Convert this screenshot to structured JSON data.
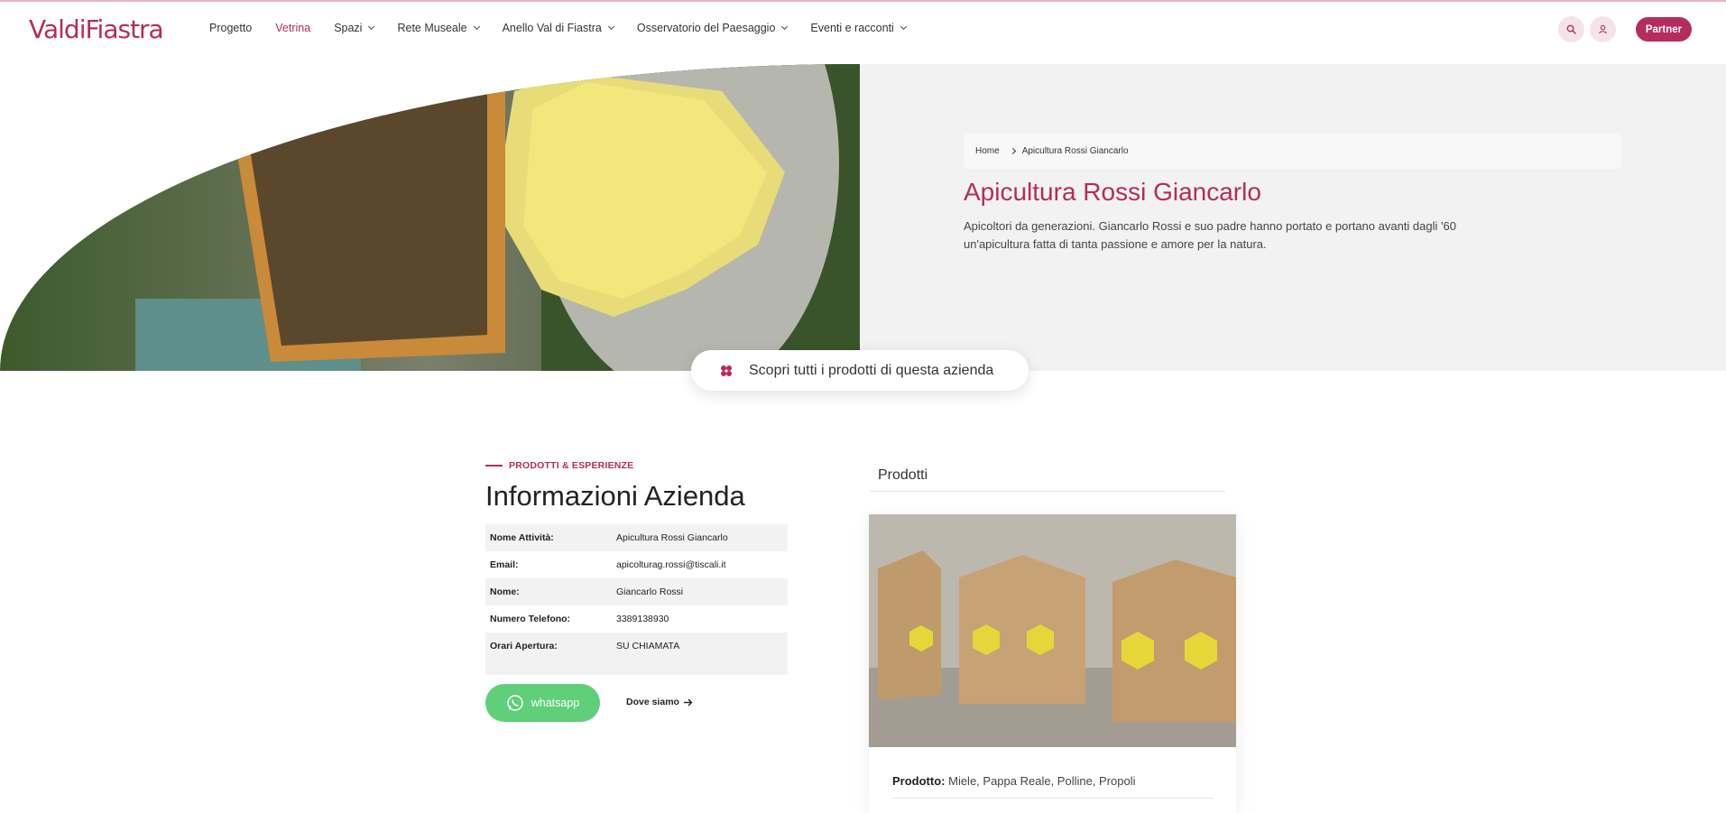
{
  "brand": {
    "logo": "ValdiFiastra",
    "accent": "#b52c5e"
  },
  "nav": {
    "items": [
      {
        "label": "Progetto",
        "dropdown": false,
        "active": false
      },
      {
        "label": "Vetrina",
        "dropdown": false,
        "active": true
      },
      {
        "label": "Spazi",
        "dropdown": true,
        "active": false
      },
      {
        "label": "Rete Museale",
        "dropdown": true,
        "active": false
      },
      {
        "label": "Anello Val di Fiastra",
        "dropdown": true,
        "active": false
      },
      {
        "label": "Osservatorio del Paesaggio",
        "dropdown": true,
        "active": false
      },
      {
        "label": "Eventi e racconti",
        "dropdown": true,
        "active": false
      }
    ],
    "search_icon": "search-icon",
    "user_icon": "user-icon",
    "partner_label": "Partner"
  },
  "breadcrumb": {
    "home": "Home",
    "current": "Apicultura Rossi Giancarlo"
  },
  "hero": {
    "title": "Apicultura Rossi Giancarlo",
    "description": "Apicoltori da generazioni. Giancarlo Rossi e suo padre hanno portato e portano avanti dagli '60 un'apicultura fatta di tanta passione e amore per la natura."
  },
  "cta": {
    "label": "Scopri tutti i prodotti di questa azienda",
    "icon": "flower-icon"
  },
  "info": {
    "eyebrow": "PRODOTTI & ESPERIENZE",
    "title": "Informazioni Azienda",
    "rows": [
      {
        "key": "Nome Attività:",
        "value": "Apicultura Rossi Giancarlo"
      },
      {
        "key": "Email:",
        "value": "apicolturag.rossi@tiscali.it"
      },
      {
        "key": "Nome:",
        "value": "Giancarlo Rossi"
      },
      {
        "key": "Numero Telefono:",
        "value": "3389138930"
      },
      {
        "key": "Orari Apertura:",
        "value": "SU CHIAMATA"
      }
    ],
    "whatsapp_label": "whatsapp",
    "dove_label": "Dove siamo"
  },
  "products": {
    "heading": "Prodotti",
    "card": {
      "label": "Prodotto:",
      "value": "Miele, Pappa Reale, Polline, Propoli"
    }
  }
}
